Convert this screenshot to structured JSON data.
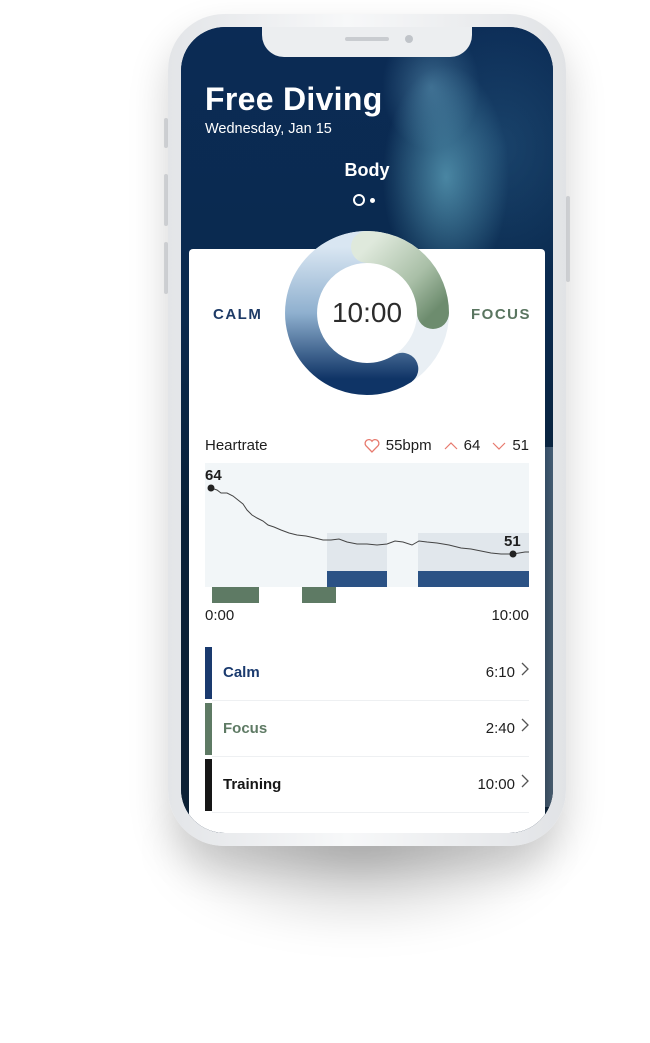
{
  "header": {
    "title": "Free Diving",
    "date": "Wednesday, Jan 15",
    "section": "Body"
  },
  "ring": {
    "time": "10:00",
    "left_label": "CALM",
    "right_label": "FOCUS",
    "calm_color": "#0f3466",
    "focus_color": "#6d8c6e"
  },
  "heartrate": {
    "label": "Heartrate",
    "avg": "55bpm",
    "max": "64",
    "min": "51",
    "start_label": "64",
    "end_label": "51",
    "time_start": "0:00",
    "time_end": "10:00"
  },
  "sessions": [
    {
      "label": "Calm",
      "value": "6:10",
      "color": "#1a3a6e"
    },
    {
      "label": "Focus",
      "value": "2:40",
      "color": "#5e7a64"
    },
    {
      "label": "Training",
      "value": "10:00",
      "color": "#161616"
    }
  ],
  "icons": {
    "heart": "heart-icon",
    "up": "arrow-up-icon",
    "down": "arrow-down-icon",
    "chevron": "chevron-right-icon"
  }
}
